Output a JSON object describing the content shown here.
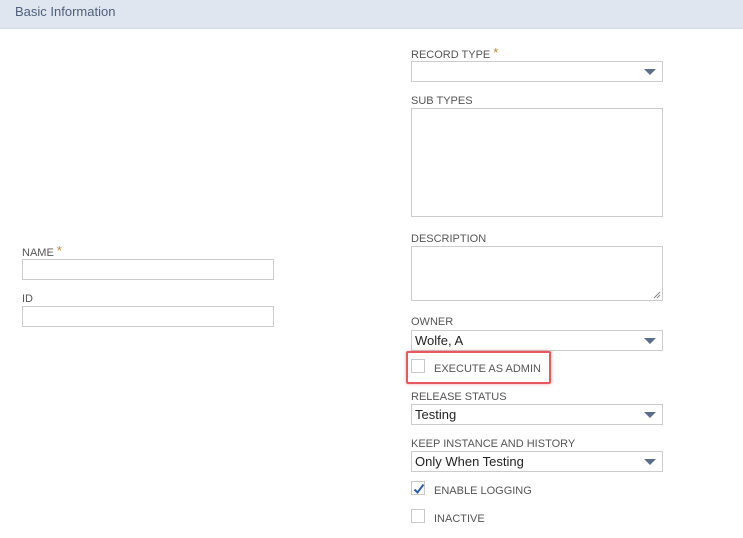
{
  "header": {
    "title": "Basic Information"
  },
  "left_fields": {
    "name": {
      "label": "NAME",
      "required_mark": "*",
      "value": ""
    },
    "id": {
      "label": "ID",
      "value": ""
    }
  },
  "right_fields": {
    "record_type": {
      "label": "RECORD TYPE",
      "required_mark": "*",
      "value": ""
    },
    "sub_types": {
      "label": "SUB TYPES"
    },
    "description": {
      "label": "DESCRIPTION",
      "value": ""
    },
    "owner": {
      "label": "OWNER",
      "value": "Wolfe, A"
    },
    "execute_as_admin": {
      "label": "EXECUTE AS ADMIN",
      "checked": false
    },
    "release_status": {
      "label": "RELEASE STATUS",
      "value": "Testing"
    },
    "keep_instance": {
      "label": "KEEP INSTANCE AND HISTORY",
      "value": "Only When Testing"
    },
    "enable_logging": {
      "label": "ENABLE LOGGING",
      "checked": true
    },
    "inactive": {
      "label": "INACTIVE",
      "checked": false
    }
  },
  "colors": {
    "header_bg": "#e0e6ef",
    "required_mark": "#c4852d",
    "highlight_border": "#e8585f",
    "arrow": "#5a6e8c",
    "check": "#2d5fa8"
  }
}
